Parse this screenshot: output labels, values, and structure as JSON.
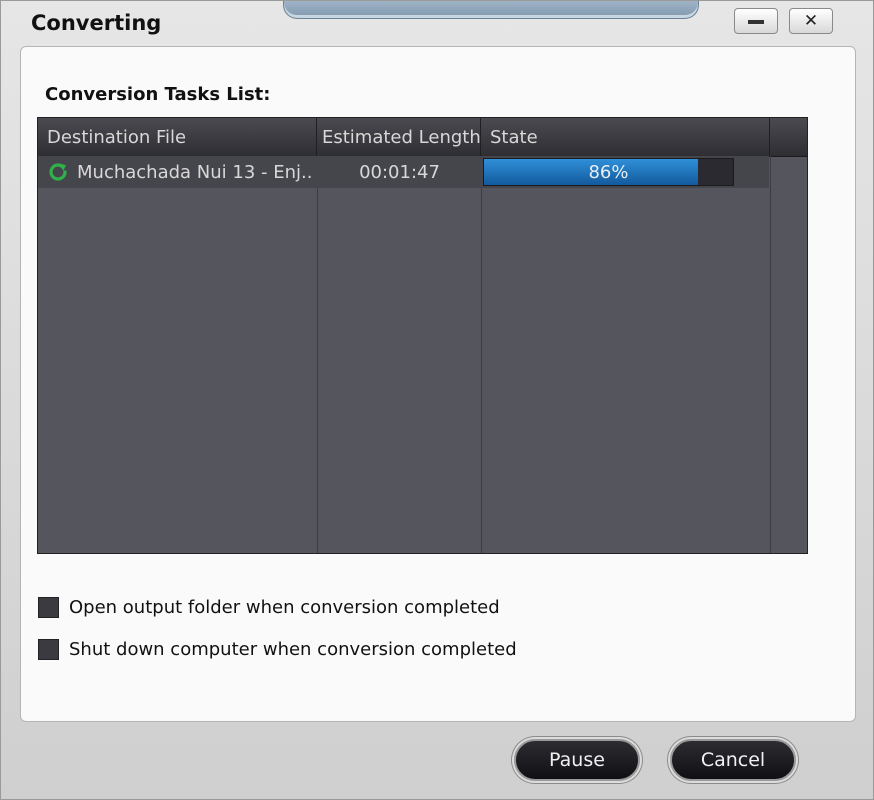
{
  "window": {
    "title": "Converting",
    "minimize_icon": "minimize-icon",
    "close_glyph": "✕"
  },
  "tasks": {
    "label": "Conversion Tasks List:",
    "columns": [
      "Destination File",
      "Estimated Length",
      "State"
    ],
    "rows": [
      {
        "icon": "refresh-icon",
        "destination": "Muchachada Nui 13 - Enj...",
        "length": "00:01:47",
        "progress": 0.86,
        "state_text": "86%"
      }
    ]
  },
  "options": {
    "open_folder": {
      "label": "Open output folder when conversion completed",
      "checked": false
    },
    "shutdown": {
      "label": "Shut down computer when conversion completed",
      "checked": false
    }
  },
  "buttons": {
    "pause": "Pause",
    "cancel": "Cancel"
  },
  "colors": {
    "progress_fill": "#2f8fd7",
    "icon_green": "#2fb24a",
    "grid_bg": "#55555d"
  }
}
